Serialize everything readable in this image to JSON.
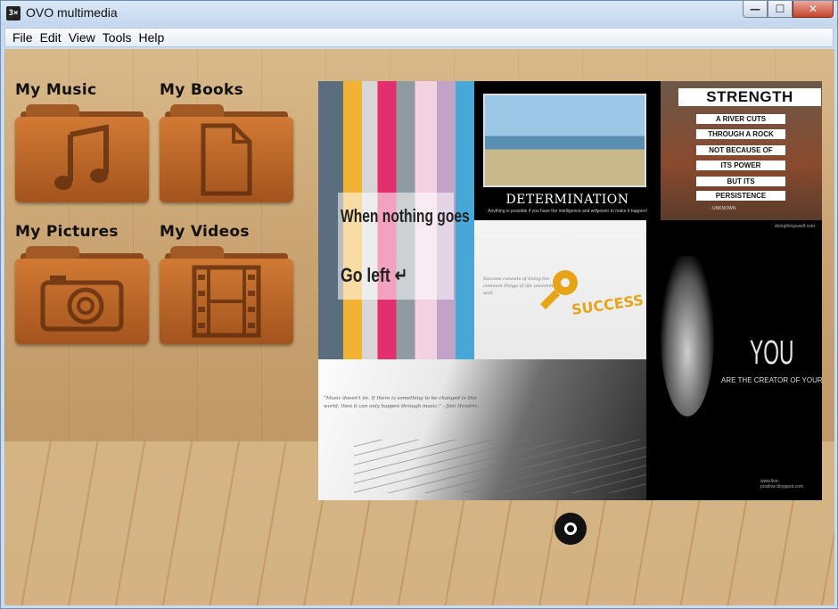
{
  "window": {
    "title": "OVO multimedia",
    "app_icon_text": "3×",
    "controls": {
      "minimize": "—",
      "maximize": "☐",
      "close": "✕"
    }
  },
  "menu": [
    "File",
    "Edit",
    "View",
    "Tools",
    "Help"
  ],
  "folders": [
    {
      "label": "My Music",
      "icon": "music-note-icon"
    },
    {
      "label": "My Books",
      "icon": "document-icon"
    },
    {
      "label": "My Pictures",
      "icon": "camera-icon"
    },
    {
      "label": "My Videos",
      "icon": "film-strip-icon"
    }
  ],
  "collage": {
    "stripes": {
      "line1": "When nothing goes right",
      "line2": "Go left ↵"
    },
    "determination": {
      "caption": "DETERMINATION",
      "sub": "Anything is possible if you have the intelligence and willpower to make it happen!"
    },
    "strength": {
      "heading": "STRENGTH",
      "lines": [
        "A RIVER CUTS",
        "THROUGH A ROCK",
        "NOT BECAUSE OF",
        "ITS POWER",
        "BUT ITS",
        "PERSISTENCE"
      ],
      "credit": "- UNKNOWN"
    },
    "success": {
      "quote": "Success consists of doing the common things of life uncommonly well.",
      "word": "SUCCESS"
    },
    "you": {
      "big": "YOU",
      "small": "ARE THE CREATOR OF YOUR OWN DESTINY.",
      "site": "www.live-positive.blogspot.com"
    },
    "guitar": {
      "quote": "“Music doesn't lie. If there is something to be changed in this world, then it can only happen through music.” - Jimi Hendrix."
    }
  },
  "footer_icon": "chrome-icon"
}
